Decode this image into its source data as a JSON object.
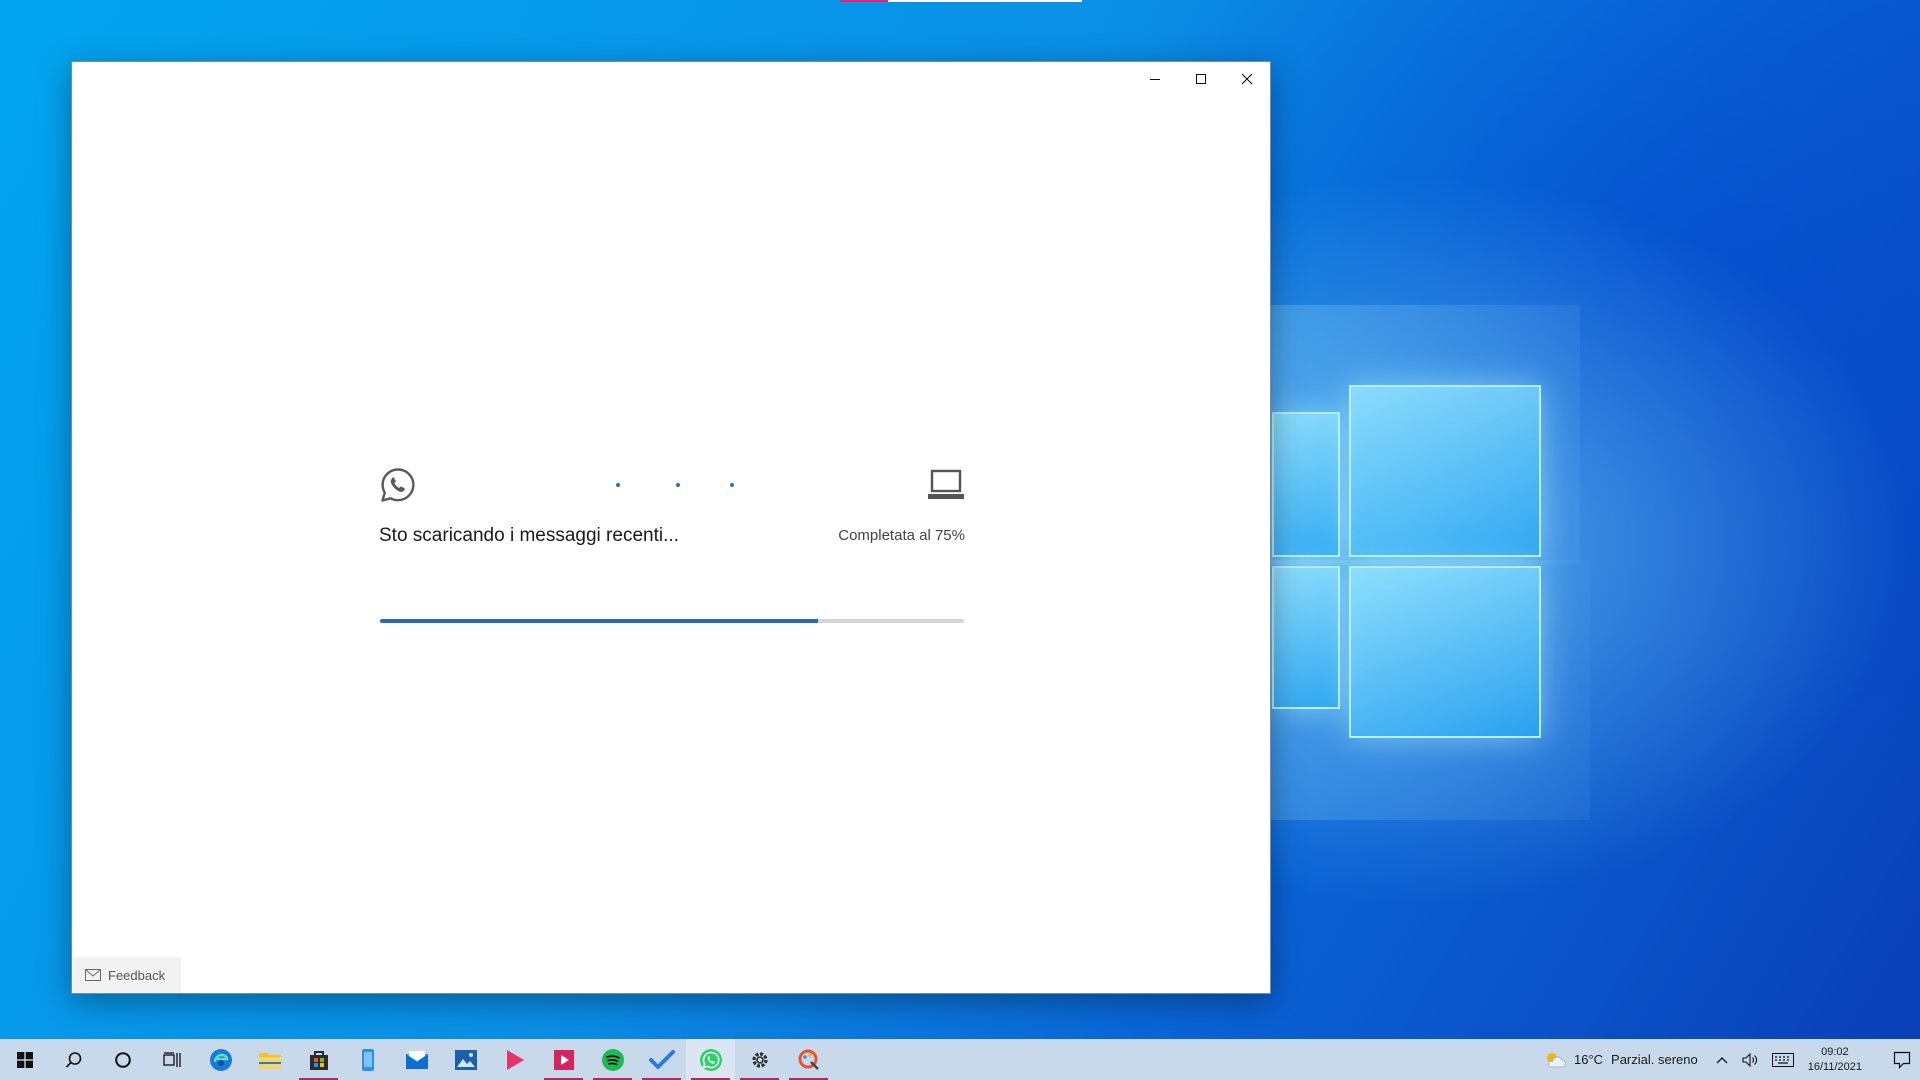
{
  "window": {
    "controls": {
      "minimize": "minimize-icon",
      "maximize": "maximize-icon",
      "close": "close-icon"
    },
    "sync": {
      "status": "Sto scaricando i messaggi recenti...",
      "percent_label": "Completata al 75%",
      "progress": 0.75,
      "phone_icon": "whatsapp-icon",
      "device_icon": "laptop-icon"
    },
    "feedback_label": "Feedback"
  },
  "taskbar": {
    "apps": [
      {
        "name": "start",
        "icon": "windows-icon"
      },
      {
        "name": "search",
        "icon": "search-icon"
      },
      {
        "name": "cortana",
        "icon": "cortana-icon"
      },
      {
        "name": "task-view",
        "icon": "task-view-icon"
      },
      {
        "name": "edge",
        "icon": "edge-icon"
      },
      {
        "name": "file-explorer",
        "icon": "folder-icon"
      },
      {
        "name": "store",
        "icon": "store-icon"
      },
      {
        "name": "phone",
        "icon": "phone-icon"
      },
      {
        "name": "mail",
        "icon": "mail-icon"
      },
      {
        "name": "photos",
        "icon": "photos-icon"
      },
      {
        "name": "media",
        "icon": "play-icon"
      },
      {
        "name": "video",
        "icon": "video-icon"
      },
      {
        "name": "spotify",
        "icon": "spotify-icon"
      },
      {
        "name": "todo",
        "icon": "todo-icon"
      },
      {
        "name": "whatsapp",
        "icon": "whatsapp-icon"
      },
      {
        "name": "settings",
        "icon": "gear-icon"
      },
      {
        "name": "paint",
        "icon": "paint-icon"
      }
    ],
    "weather": {
      "temperature": "16°C",
      "condition": "Parzial. sereno"
    },
    "clock": {
      "time": "09:02",
      "date": "16/11/2021"
    }
  },
  "colors": {
    "progress_fill": "#2b68b8",
    "progress_track": "#d6d6d6",
    "taskbar": "#c8d9ec",
    "active_underline": "#b0295f"
  }
}
